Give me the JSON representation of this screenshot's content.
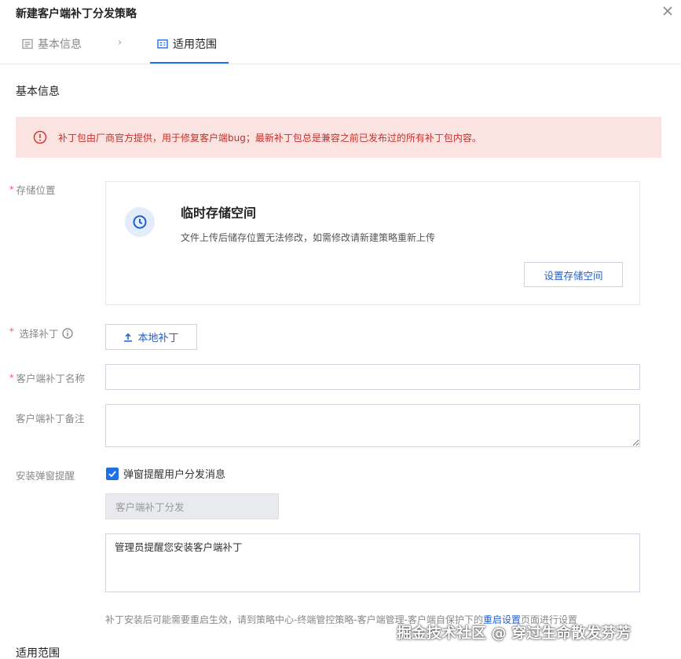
{
  "dialog": {
    "title": "新建客户端补丁分发策略"
  },
  "tabs": [
    {
      "label": "基本信息",
      "active": false
    },
    {
      "label": "适用范围",
      "active": true
    }
  ],
  "tab_separator": "›",
  "section": {
    "basic_info": "基本信息",
    "scope": "适用范围"
  },
  "alert": {
    "text": "补丁包由厂商官方提供，用于修复客户端bug；最新补丁包总是兼容之前已发布过的所有补丁包内容。"
  },
  "storage": {
    "label": "存储位置",
    "title": "临时存储空间",
    "description": "文件上传后储存位置无法修改，如需修改请新建策略重新上传",
    "button": "设置存储空间"
  },
  "patch": {
    "label": "选择补丁",
    "upload_button": "本地补丁"
  },
  "patch_name": {
    "label": "客户端补丁名称",
    "value": ""
  },
  "patch_note": {
    "label": "客户端补丁备注",
    "value": ""
  },
  "popup": {
    "label": "安装弹窗提醒",
    "checkbox_label": "弹窗提醒用户分发消息",
    "checked": true,
    "title_placeholder": "客户端补丁分发",
    "message": "管理员提醒您安装客户端补丁"
  },
  "hint": {
    "prefix": "补丁安装后可能需要重启生效，请到策略中心-终端管控策略-客户端管理-客户端自保护下的",
    "link": "重启设置",
    "suffix": "页面进行设置"
  },
  "watermark": "掘金技术社区 @ 穿过生命散发芬芳",
  "colors": {
    "primary": "#1f6feb",
    "link": "#1f5fcf",
    "alert_bg": "#fbe3e2",
    "alert_text": "#c5302b"
  }
}
